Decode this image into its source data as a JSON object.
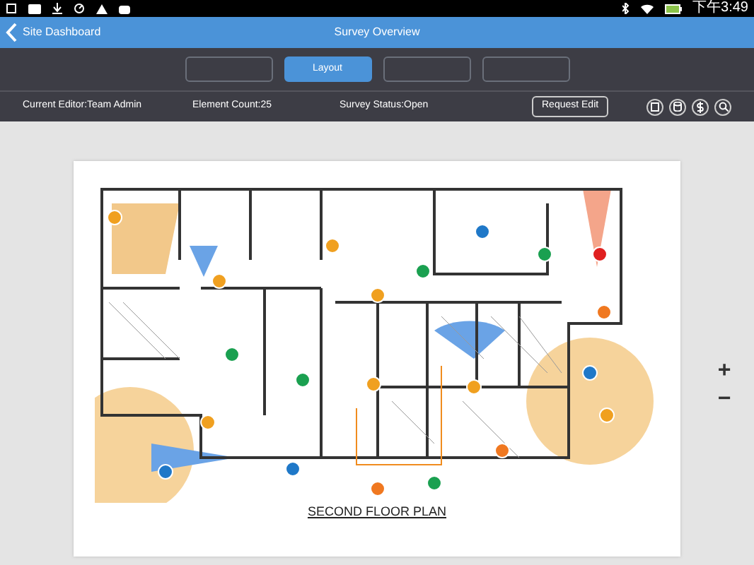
{
  "status_bar": {
    "time": "下午3:49"
  },
  "nav_bar": {
    "back_label": "Site Dashboard",
    "title": "Survey Overview"
  },
  "segments": [
    {
      "selected": false
    },
    {
      "label": "Layout",
      "selected": true
    },
    {
      "selected": false
    },
    {
      "selected": false
    }
  ],
  "info_bar": {
    "editor": "Current Editor:Team Admin",
    "element_count": "Element Count:25",
    "survey_status": "Survey Status:Open",
    "request_button": "Request Edit"
  },
  "plan": {
    "title": "SECOND FLOOR PLAN"
  },
  "zoom": {
    "in": "+",
    "out": "−"
  }
}
